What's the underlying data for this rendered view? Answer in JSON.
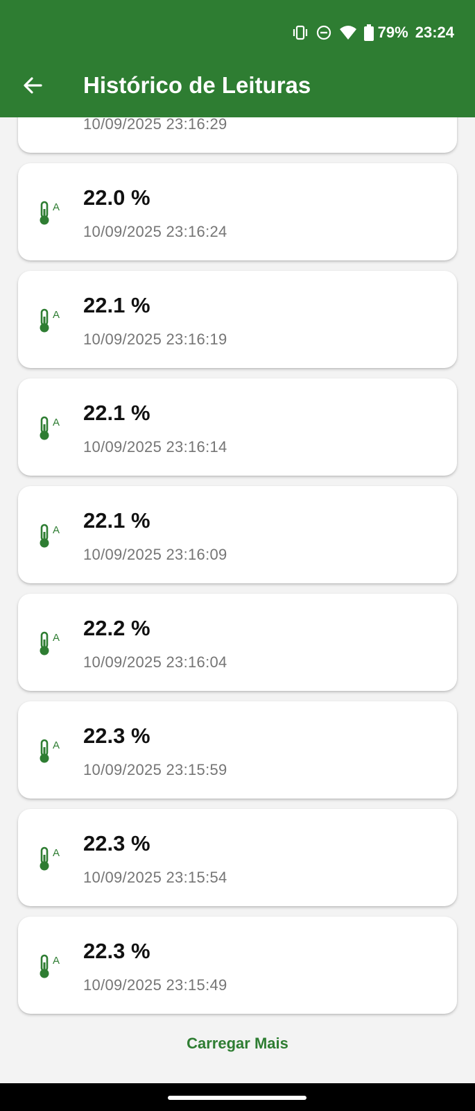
{
  "colors": {
    "primary": "#2e7d32",
    "background": "#f3f3f3",
    "card": "#ffffff",
    "time_text": "#757575"
  },
  "status_bar": {
    "icons": [
      "vibrate-icon",
      "do-not-disturb-icon",
      "wifi-icon",
      "battery-icon"
    ],
    "battery": "79%",
    "clock": "23:24"
  },
  "toolbar": {
    "back_icon": "arrow-back-icon",
    "title": "Histórico de Leituras"
  },
  "readings": [
    {
      "value": "",
      "time": "10/09/2025 23:16:29",
      "icon": "thermometer-auto-icon"
    },
    {
      "value": "22.0 %",
      "time": "10/09/2025 23:16:24",
      "icon": "thermometer-auto-icon"
    },
    {
      "value": "22.1 %",
      "time": "10/09/2025 23:16:19",
      "icon": "thermometer-auto-icon"
    },
    {
      "value": "22.1 %",
      "time": "10/09/2025 23:16:14",
      "icon": "thermometer-auto-icon"
    },
    {
      "value": "22.1 %",
      "time": "10/09/2025 23:16:09",
      "icon": "thermometer-auto-icon"
    },
    {
      "value": "22.2 %",
      "time": "10/09/2025 23:16:04",
      "icon": "thermometer-auto-icon"
    },
    {
      "value": "22.3 %",
      "time": "10/09/2025 23:15:59",
      "icon": "thermometer-auto-icon"
    },
    {
      "value": "22.3 %",
      "time": "10/09/2025 23:15:54",
      "icon": "thermometer-auto-icon"
    },
    {
      "value": "22.3 %",
      "time": "10/09/2025 23:15:49",
      "icon": "thermometer-auto-icon"
    }
  ],
  "load_more_label": "Carregar Mais"
}
